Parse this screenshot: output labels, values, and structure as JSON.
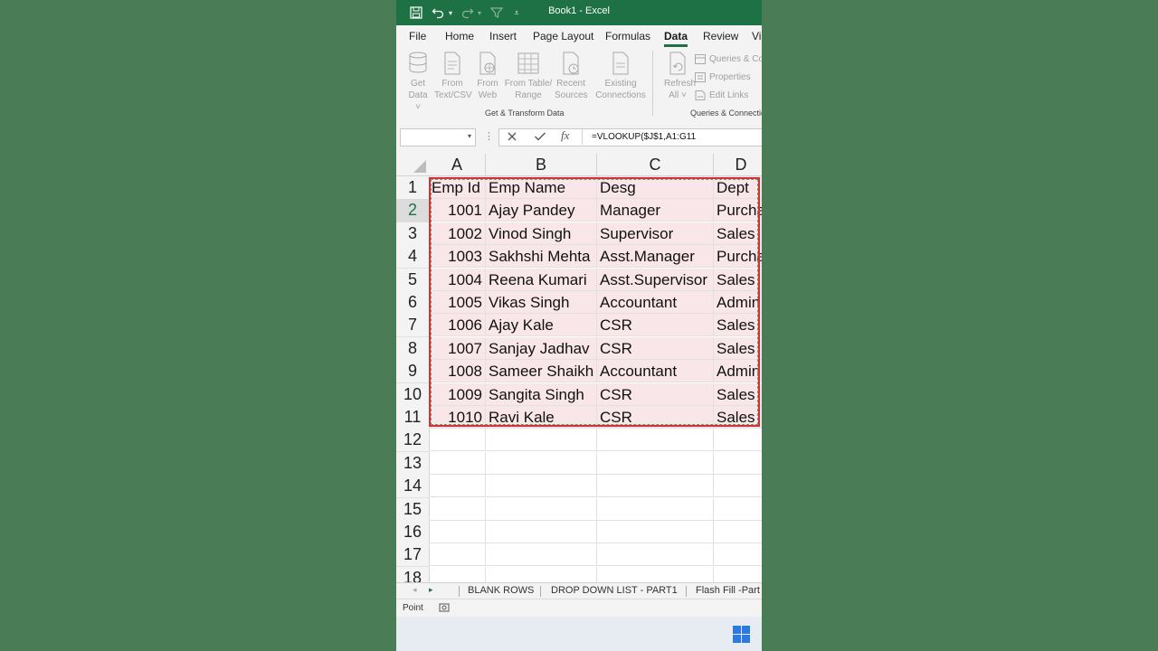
{
  "window": {
    "title": "Book1  -  Excel"
  },
  "menu": {
    "tabs": [
      {
        "label": "File"
      },
      {
        "label": "Home"
      },
      {
        "label": "Insert"
      },
      {
        "label": "Page Layout"
      },
      {
        "label": "Formulas"
      },
      {
        "label": "Data"
      },
      {
        "label": "Review"
      },
      {
        "label": "Vi"
      }
    ],
    "active": "Data"
  },
  "ribbon": {
    "get_transform": {
      "group_label": "Get & Transform Data",
      "buttons": [
        {
          "line1": "Get",
          "line2": "Data ˅"
        },
        {
          "line1": "From",
          "line2": "Text/CSV"
        },
        {
          "line1": "From",
          "line2": "Web"
        },
        {
          "line1": "From Table/",
          "line2": "Range"
        },
        {
          "line1": "Recent",
          "line2": "Sources"
        },
        {
          "line1": "Existing",
          "line2": "Connections"
        }
      ]
    },
    "queries": {
      "group_label": "Queries & Connectio",
      "refresh": {
        "line1": "Refresh",
        "line2": "All ˅"
      },
      "small": [
        "Queries & Co",
        "Properties",
        "Edit Links"
      ]
    }
  },
  "formula_bar": {
    "name_box": "",
    "formula": "=VLOOKUP($J$1,A1:G11",
    "fx": "fx"
  },
  "grid": {
    "columns": [
      "A",
      "B",
      "C",
      "D"
    ],
    "rows": [
      [
        "Emp Id",
        "Emp Name",
        "Desg",
        "Dept"
      ],
      [
        "1001",
        "Ajay Pandey",
        "Manager",
        "Purcha"
      ],
      [
        "1002",
        "Vinod Singh",
        "Supervisor",
        "Sales"
      ],
      [
        "1003",
        "Sakhshi Mehta",
        "Asst.Manager",
        "Purcha"
      ],
      [
        "1004",
        "Reena Kumari",
        "Asst.Supervisor",
        "Sales"
      ],
      [
        "1005",
        "Vikas Singh",
        "Accountant",
        "Admin"
      ],
      [
        "1006",
        "Ajay Kale",
        "CSR",
        "Sales"
      ],
      [
        "1007",
        "Sanjay Jadhav",
        "CSR",
        "Sales"
      ],
      [
        "1008",
        "Sameer Shaikh",
        "Accountant",
        "Admin"
      ],
      [
        "1009",
        "Sangita Singh",
        "CSR",
        "Sales"
      ],
      [
        "1010",
        "Ravi Kale",
        "CSR",
        "Sales"
      ]
    ],
    "row_numbers": [
      "1",
      "2",
      "3",
      "4",
      "5",
      "6",
      "7",
      "8",
      "9",
      "10",
      "11",
      "12",
      "13",
      "14",
      "15",
      "16",
      "17",
      "18"
    ],
    "selected_row": "2"
  },
  "sheets": {
    "tabs": [
      "BLANK ROWS",
      "DROP DOWN LIST - PART1",
      "Flash Fill -Part"
    ]
  },
  "status": {
    "mode": "Point"
  },
  "colors": {
    "excel_green": "#1e7145",
    "selection_red": "#d13438",
    "highlight": "#f9e6e8"
  }
}
